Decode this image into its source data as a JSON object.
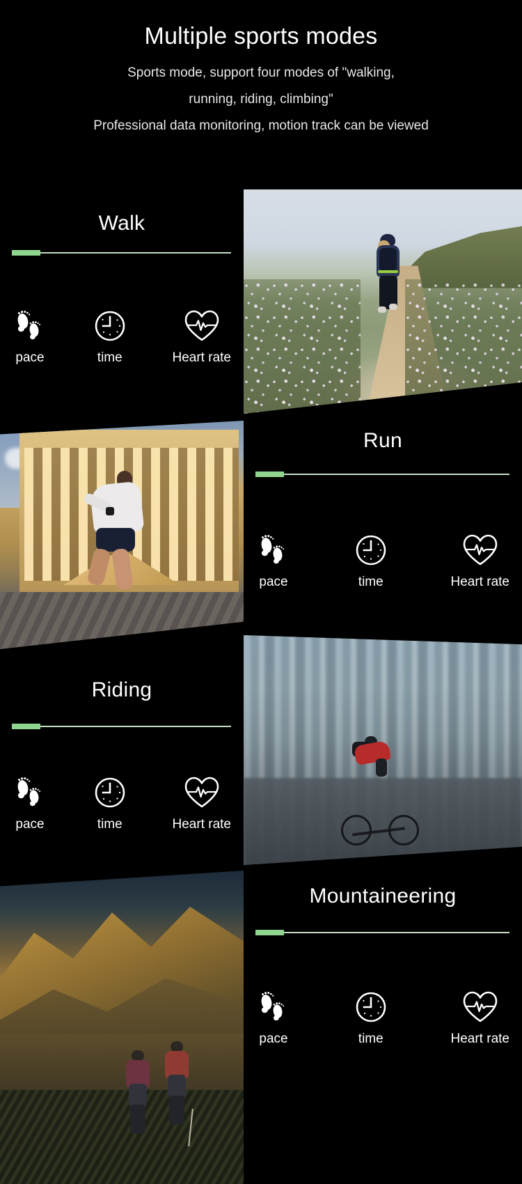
{
  "header": {
    "title": "Multiple sports modes",
    "subtitle_line1": "Sports mode, support four modes of \"walking,",
    "subtitle_line2": "running, riding, climbing\"",
    "subtitle_line3": "Professional data monitoring, motion track can be viewed"
  },
  "theme": {
    "background": "#000000",
    "text": "#ffffff",
    "accent_green": "#8fd48f",
    "divider_line": "#c4e0c4"
  },
  "metric_icons": {
    "pace": "footprints-icon",
    "time": "clock-icon",
    "heart_rate": "heart-pulse-icon"
  },
  "sections": [
    {
      "id": "walk",
      "title": "Walk",
      "photo_alt": "woman-walking-flower-path-photo",
      "metrics": [
        {
          "label": "pace",
          "icon": "footprints-icon"
        },
        {
          "label": "time",
          "icon": "clock-icon"
        },
        {
          "label": "Heart rate",
          "icon": "heart-pulse-icon"
        }
      ]
    },
    {
      "id": "run",
      "title": "Run",
      "photo_alt": "man-running-past-building-photo",
      "metrics": [
        {
          "label": "pace",
          "icon": "footprints-icon"
        },
        {
          "label": "time",
          "icon": "clock-icon"
        },
        {
          "label": "Heart rate",
          "icon": "heart-pulse-icon"
        }
      ]
    },
    {
      "id": "riding",
      "title": "Riding",
      "photo_alt": "cyclist-in-city-motion-blur-photo",
      "metrics": [
        {
          "label": "pace",
          "icon": "footprints-icon"
        },
        {
          "label": "time",
          "icon": "clock-icon"
        },
        {
          "label": "Heart rate",
          "icon": "heart-pulse-icon"
        }
      ]
    },
    {
      "id": "mountaineering",
      "title": "Mountaineering",
      "photo_alt": "two-hikers-on-mountain-ridge-photo",
      "metrics": [
        {
          "label": "pace",
          "icon": "footprints-icon"
        },
        {
          "label": "time",
          "icon": "clock-icon"
        },
        {
          "label": "Heart rate",
          "icon": "heart-pulse-icon"
        }
      ]
    }
  ]
}
